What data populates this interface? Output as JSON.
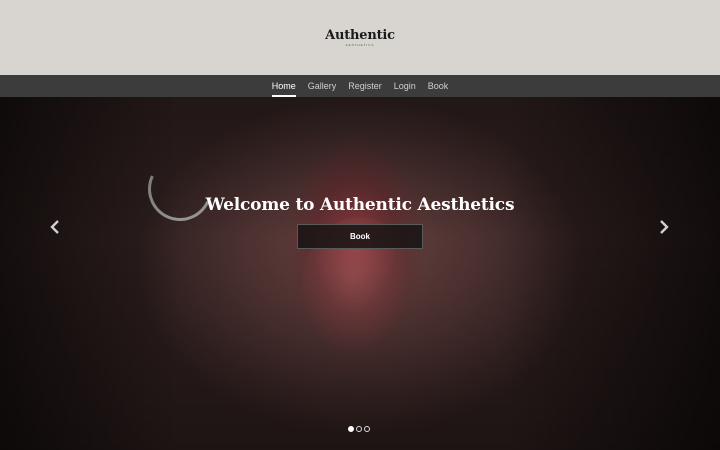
{
  "header": {
    "logo_text": "Authentic",
    "logo_subtext": "AESTHETICS"
  },
  "nav": {
    "items": [
      {
        "label": "Home",
        "active": true
      },
      {
        "label": "Gallery",
        "active": false
      },
      {
        "label": "Register",
        "active": false
      },
      {
        "label": "Login",
        "active": false
      },
      {
        "label": "Book",
        "active": false
      }
    ]
  },
  "hero": {
    "title": "Welcome to Authentic Aesthetics",
    "button_label": "Book",
    "prev_icon": "chevron-left-icon",
    "next_icon": "chevron-right-icon",
    "slides_count": 3,
    "active_slide": 1
  },
  "colors": {
    "header_bg": "#d8d5d0",
    "nav_bg": "#3c3c3c",
    "accent": "#ffffff"
  }
}
